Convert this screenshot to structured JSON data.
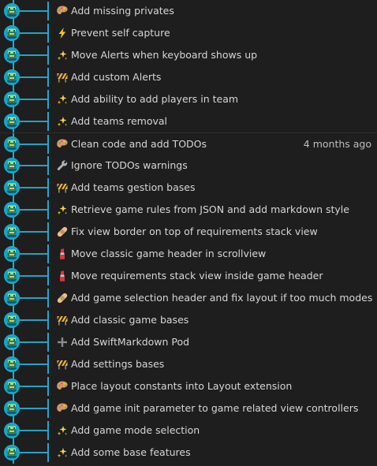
{
  "commits": [
    {
      "icon": "art-palette-icon",
      "message": "Add missing privates",
      "date": ""
    },
    {
      "icon": "zap-icon",
      "message": "Prevent self capture",
      "date": ""
    },
    {
      "icon": "sparkles-icon",
      "message": "Move Alerts when keyboard shows up",
      "date": ""
    },
    {
      "icon": "construction-icon",
      "message": "Add custom Alerts",
      "date": ""
    },
    {
      "icon": "sparkles-icon",
      "message": "Add ability to add players in team",
      "date": ""
    },
    {
      "icon": "sparkles-icon",
      "message": "Add teams removal",
      "date": ""
    },
    {
      "icon": "art-palette-icon",
      "message": "Clean code and add TODOs",
      "date": "4 months ago"
    },
    {
      "icon": "wrench-icon",
      "message": "Ignore TODOs warnings",
      "date": ""
    },
    {
      "icon": "construction-icon",
      "message": "Add teams gestion bases",
      "date": ""
    },
    {
      "icon": "sparkles-icon",
      "message": "Retrieve game rules from JSON and add markdown style",
      "date": ""
    },
    {
      "icon": "bandage-icon",
      "message": "Fix view border on top of requirements stack view",
      "date": ""
    },
    {
      "icon": "lipstick-icon",
      "message": "Move classic game header in scrollview",
      "date": ""
    },
    {
      "icon": "lipstick-icon",
      "message": "Move requirements stack view inside game header",
      "date": ""
    },
    {
      "icon": "bandage-icon",
      "message": "Add game selection header and fix layout if too much modes",
      "date": ""
    },
    {
      "icon": "construction-icon",
      "message": "Add classic game bases",
      "date": ""
    },
    {
      "icon": "plus-icon",
      "message": "Add SwiftMarkdown Pod",
      "date": ""
    },
    {
      "icon": "construction-icon",
      "message": "Add settings bases",
      "date": ""
    },
    {
      "icon": "art-palette-icon",
      "message": "Place layout constants into Layout extension",
      "date": ""
    },
    {
      "icon": "art-palette-icon",
      "message": "Add game init parameter to game related view controllers",
      "date": ""
    },
    {
      "icon": "sparkles-icon",
      "message": "Add game mode selection",
      "date": ""
    },
    {
      "icon": "sparkles-icon",
      "message": "Add some base features",
      "date": ""
    }
  ],
  "colors": {
    "background": "#1e1e1e",
    "graph_line": "#28a7c9",
    "avatar": "#18a3c6",
    "text": "#d6d6d6",
    "date_text": "#bdbdbd"
  }
}
